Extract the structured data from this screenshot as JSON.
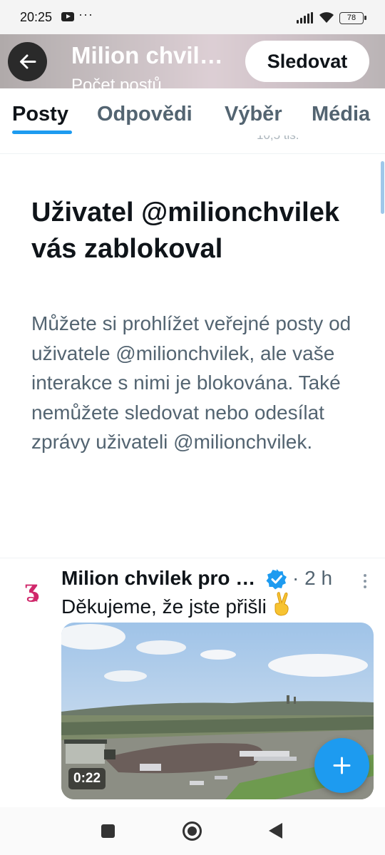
{
  "status_bar": {
    "time": "20:25",
    "more": "···",
    "battery": "78",
    "icons": [
      "youtube-icon",
      "signal-icon",
      "wifi-icon",
      "battery-icon"
    ]
  },
  "header": {
    "title": "Milion chvilek pro demokracii",
    "subtitle": "Počet postů",
    "follow_label": "Sledovat",
    "back_icon": "arrow-left-icon"
  },
  "tabs": [
    {
      "label": "Posty",
      "active": true
    },
    {
      "label": "Odpovědi",
      "active": false
    },
    {
      "label": "Výběr",
      "active": false
    },
    {
      "label": "Média",
      "active": false
    }
  ],
  "ghost_row": {
    "views": "10,5 tis."
  },
  "blocked": {
    "title": "Uživatel @milionchvilek vás zablokoval",
    "description": "Můžete si prohlížet veřejné posty od uživatele @milionchvilek, ale vaše interakce s nimi je blokována. Také nemůžete sledovat nebo odesílat zprávy uživateli @milionchvilek."
  },
  "tweet": {
    "author": "Milion chvilek pro demokracii",
    "verified": true,
    "separator": "·",
    "time": "2 h",
    "text": "Děkujeme, že jste přišli",
    "emoji_icon": "victory-hand-icon",
    "video_duration": "0:22"
  },
  "fab": {
    "icon": "plus-icon"
  },
  "colors": {
    "accent": "#1d9bf0",
    "text_primary": "#0f1419",
    "text_secondary": "#536471",
    "verified": "#1d9bf0"
  }
}
